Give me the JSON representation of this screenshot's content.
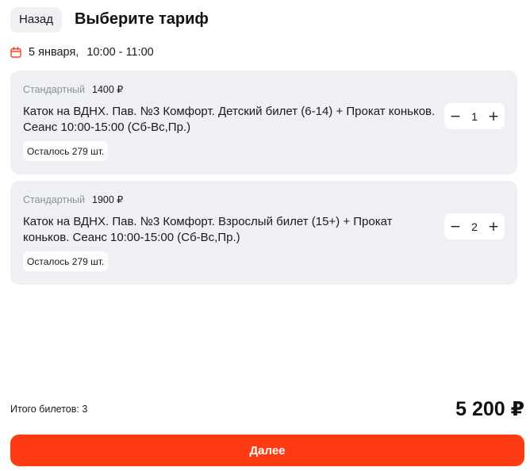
{
  "header": {
    "back_label": "Назад",
    "title": "Выберите тариф"
  },
  "session": {
    "icon": "calendar-icon",
    "date": "5 января,",
    "time": "10:00 - 11:00"
  },
  "tariffs": [
    {
      "tier": "Стандартный",
      "price": "1400 ₽",
      "description": "Каток на ВДНХ. Пав. №3 Комфорт. Детский билет (6-14) + Прокат коньков. Сеанс 10:00-15:00 (Сб-Вс,Пр.)",
      "remaining": "Осталось 279 шт.",
      "quantity": "1",
      "minus": "−",
      "plus": "+"
    },
    {
      "tier": "Стандартный",
      "price": "1900 ₽",
      "description": "Каток на ВДНХ. Пав. №3 Комфорт. Взрослый билет (15+) + Прокат коньков. Сеанс 10:00-15:00 (Сб-Вс,Пр.)",
      "remaining": "Осталось 279 шт.",
      "quantity": "2",
      "minus": "−",
      "plus": "+"
    }
  ],
  "summary": {
    "tickets_label": "Итого билетов: 3",
    "total": "5 200 ₽"
  },
  "actions": {
    "next_label": "Далее"
  },
  "colors": {
    "accent": "#ff3b14",
    "card_bg": "#eef0f4",
    "muted_text": "#8b909a",
    "calendar_icon": "#ff3b14"
  }
}
